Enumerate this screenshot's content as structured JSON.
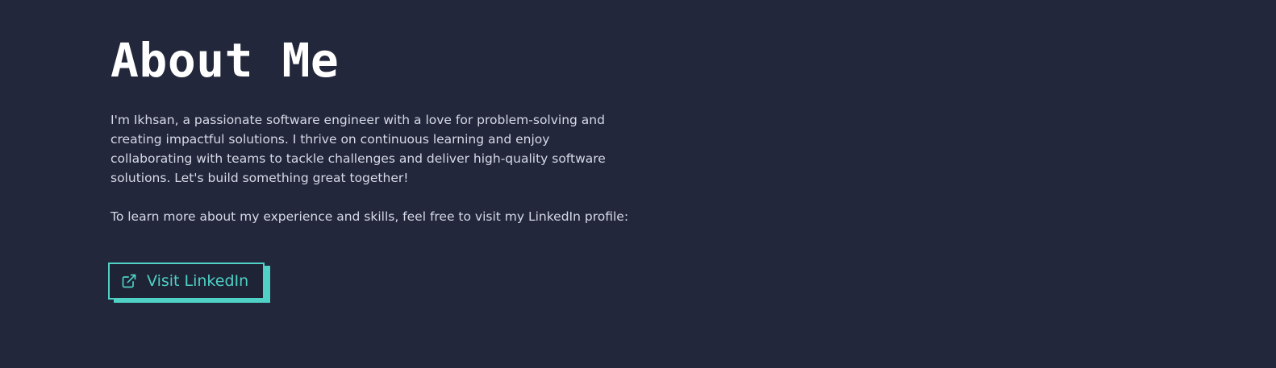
{
  "about": {
    "title": "About Me",
    "paragraph_1": "I'm Ikhsan, a passionate software engineer with a love for problem-solving and creating impactful solutions. I thrive on continuous learning and enjoy collaborating with teams to tackle challenges and deliver high-quality software solutions. Let's build something great together!",
    "paragraph_2": "To learn more about my experience and skills, feel free to visit my LinkedIn profile:",
    "button": {
      "label": "Visit LinkedIn",
      "icon": "external-link-icon"
    }
  },
  "colors": {
    "background": "#22273b",
    "accent": "#4fd1c5",
    "text": "#d7d9e6",
    "title": "#ffffff"
  }
}
